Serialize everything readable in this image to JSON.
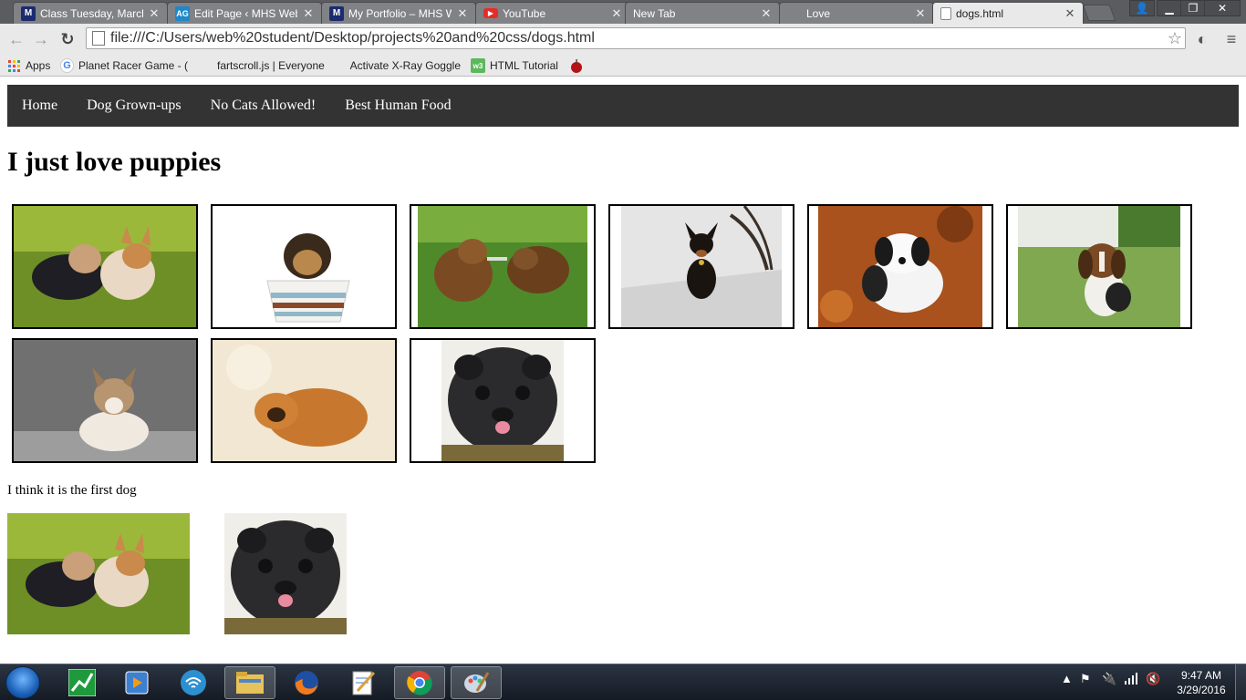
{
  "browser": {
    "tabs": [
      {
        "label": "Class Tuesday, March",
        "favicon": "M",
        "favcolor": "#1c2b6e",
        "active": false
      },
      {
        "label": "Edit Page ‹ MHS Web",
        "favicon": "AG",
        "favcolor": "#1e88c8",
        "active": false
      },
      {
        "label": "My Portfolio – MHS W",
        "favicon": "M",
        "favcolor": "#1c2b6e",
        "active": false
      },
      {
        "label": "YouTube",
        "favicon": "▶",
        "favcolor": "#e52d27",
        "active": false
      },
      {
        "label": "New Tab",
        "favicon": "",
        "favcolor": "",
        "active": false
      },
      {
        "label": "Love",
        "favicon": "",
        "favcolor": "",
        "active": false
      },
      {
        "label": "dogs.html",
        "favicon": "",
        "favcolor": "",
        "active": true
      }
    ],
    "address": "file:///C:/Users/web%20student/Desktop/projects%20and%20css/dogs.html",
    "bookmarks": [
      {
        "label": "Apps",
        "icon": "apps-grid-icon"
      },
      {
        "label": "Planet Racer Game - (",
        "icon": "google-icon"
      },
      {
        "label": "fartscroll.js | Everyone",
        "icon": "page-icon"
      },
      {
        "label": "Activate X-Ray Goggle",
        "icon": "page-icon"
      },
      {
        "label": "HTML Tutorial",
        "icon": "w3-icon"
      },
      {
        "label": "",
        "icon": "apple-icon"
      }
    ]
  },
  "site": {
    "nav": [
      "Home",
      "Dog Grown-ups",
      "No Cats Allowed!",
      "Best Human Food"
    ],
    "heading": "I just love puppies",
    "caption": "I think it is the first dog"
  },
  "taskbar": {
    "time": "9:47 AM",
    "date": "3/29/2016"
  }
}
